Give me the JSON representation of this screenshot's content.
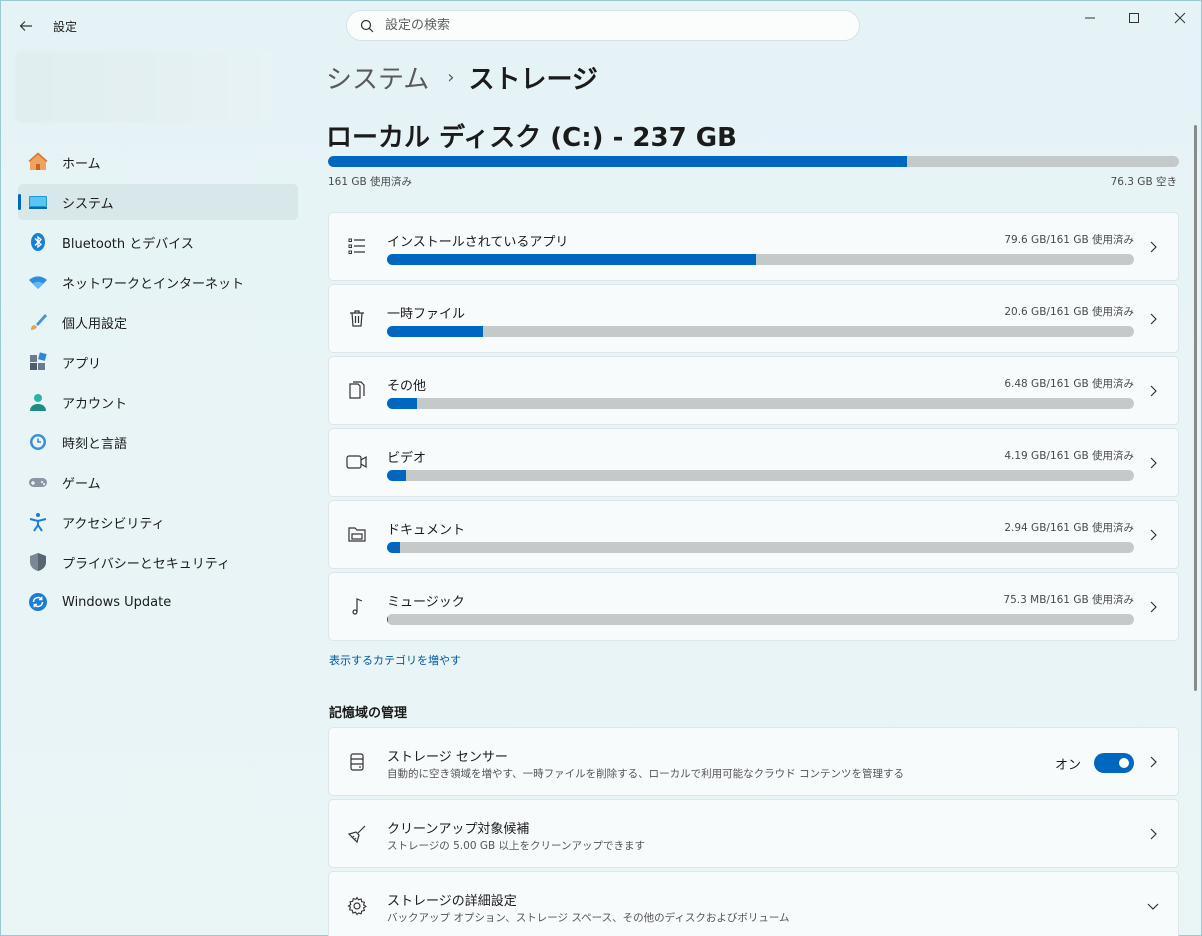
{
  "window": {
    "title": "設定",
    "search_placeholder": "設定の検索"
  },
  "sidebar": {
    "items": [
      {
        "label": "ホーム",
        "icon": "home-icon"
      },
      {
        "label": "システム",
        "icon": "system-icon",
        "active": true
      },
      {
        "label": "Bluetooth とデバイス",
        "icon": "bluetooth-icon"
      },
      {
        "label": "ネットワークとインターネット",
        "icon": "network-icon"
      },
      {
        "label": "個人用設定",
        "icon": "personalization-icon"
      },
      {
        "label": "アプリ",
        "icon": "apps-icon"
      },
      {
        "label": "アカウント",
        "icon": "account-icon"
      },
      {
        "label": "時刻と言語",
        "icon": "time-language-icon"
      },
      {
        "label": "ゲーム",
        "icon": "gaming-icon"
      },
      {
        "label": "アクセシビリティ",
        "icon": "accessibility-icon"
      },
      {
        "label": "プライバシーとセキュリティ",
        "icon": "privacy-shield-icon"
      },
      {
        "label": "Windows Update",
        "icon": "windows-update-icon"
      }
    ]
  },
  "breadcrumb": {
    "parent": "システム",
    "separator": "›",
    "current": "ストレージ"
  },
  "disk": {
    "title": "ローカル ディスク (C:) - 237 GB",
    "used_text": "161 GB 使用済み",
    "free_text": "76.3 GB 空き",
    "used_fraction": 0.68
  },
  "categories": [
    {
      "label": "インストールされているアプリ",
      "usage": "79.6 GB/161 GB 使用済み",
      "fraction": 0.494,
      "icon": "list-icon"
    },
    {
      "label": "一時ファイル",
      "usage": "20.6 GB/161 GB 使用済み",
      "fraction": 0.128,
      "icon": "trash-icon"
    },
    {
      "label": "その他",
      "usage": "6.48 GB/161 GB 使用済み",
      "fraction": 0.04,
      "icon": "other-files-icon"
    },
    {
      "label": "ビデオ",
      "usage": "4.19 GB/161 GB 使用済み",
      "fraction": 0.026,
      "icon": "video-icon"
    },
    {
      "label": "ドキュメント",
      "usage": "2.94 GB/161 GB 使用済み",
      "fraction": 0.018,
      "icon": "documents-folder-icon"
    },
    {
      "label": "ミュージック",
      "usage": "75.3 MB/161 GB 使用済み",
      "fraction": 0.0005,
      "icon": "music-note-icon"
    }
  ],
  "more_categories_link": "表示するカテゴリを増やす",
  "management": {
    "title": "記憶域の管理",
    "items": [
      {
        "title": "ストレージ センサー",
        "desc": "自動的に空き領域を増やす、一時ファイルを削除する、ローカルで利用可能なクラウド コンテンツを管理する",
        "toggle_label": "オン",
        "toggle_on": true,
        "icon": "storage-sense-icon"
      },
      {
        "title": "クリーンアップ対象候補",
        "desc": "ストレージの 5.00 GB 以上をクリーンアップできます",
        "icon": "broom-icon"
      },
      {
        "title": "ストレージの詳細設定",
        "desc": "バックアップ オプション、ストレージ スペース、その他のディスクおよびボリューム",
        "icon": "gear-icon"
      }
    ]
  },
  "colors": {
    "accent": "#0067c0",
    "bar_track": "#c4c9ca"
  }
}
